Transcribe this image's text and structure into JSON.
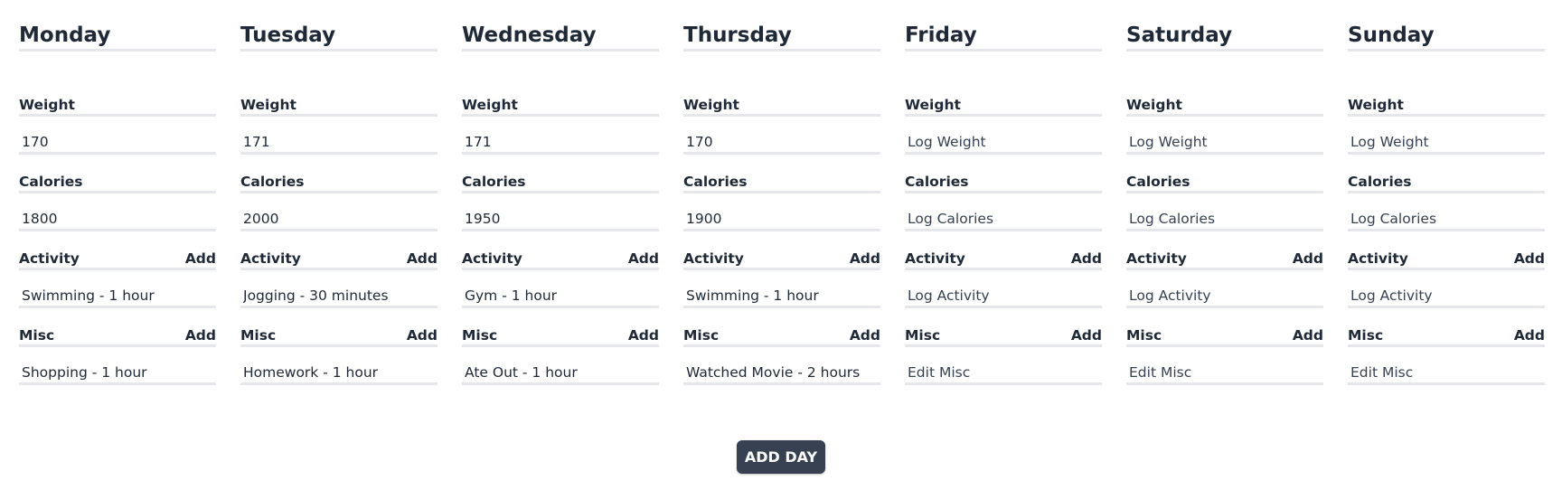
{
  "labels": {
    "weight": "Weight",
    "calories": "Calories",
    "activity": "Activity",
    "misc": "Misc",
    "add": "Add"
  },
  "placeholders": {
    "weight": "Log Weight",
    "calories": "Log Calories",
    "activity": "Log Activity",
    "misc": "Edit Misc"
  },
  "days": [
    {
      "name": "Monday",
      "weight": "170",
      "calories": "1800",
      "activity": "Swimming - 1 hour",
      "misc": "Shopping - 1 hour"
    },
    {
      "name": "Tuesday",
      "weight": "171",
      "calories": "2000",
      "activity": "Jogging - 30 minutes",
      "misc": "Homework - 1 hour"
    },
    {
      "name": "Wednesday",
      "weight": "171",
      "calories": "1950",
      "activity": "Gym - 1 hour",
      "misc": "Ate Out - 1 hour"
    },
    {
      "name": "Thursday",
      "weight": "170",
      "calories": "1900",
      "activity": "Swimming - 1 hour",
      "misc": "Watched Movie - 2 hours"
    },
    {
      "name": "Friday",
      "weight": "",
      "calories": "",
      "activity": "",
      "misc": ""
    },
    {
      "name": "Saturday",
      "weight": "",
      "calories": "",
      "activity": "",
      "misc": ""
    },
    {
      "name": "Sunday",
      "weight": "",
      "calories": "",
      "activity": "",
      "misc": ""
    }
  ],
  "add_day_label": "ADD DAY"
}
